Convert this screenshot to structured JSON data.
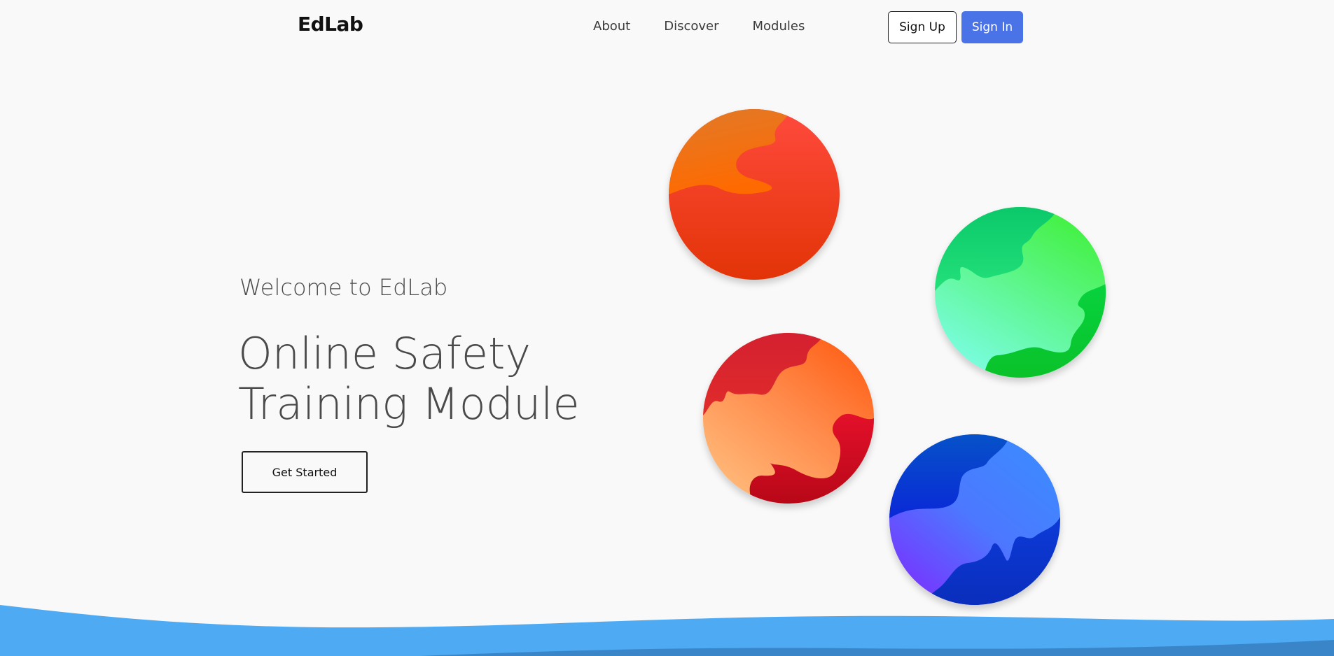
{
  "brand": {
    "name": "EdLab"
  },
  "nav": {
    "links": [
      {
        "label": "About"
      },
      {
        "label": "Discover"
      },
      {
        "label": "Modules"
      }
    ],
    "signup_label": "Sign Up",
    "signin_label": "Sign In"
  },
  "hero": {
    "subtitle": "Welcome to EdLab",
    "title_line1": "Online Safety",
    "title_line2": "Training Module",
    "cta_label": "Get Started"
  },
  "colors": {
    "accent": "#4a73e8",
    "background": "#f9f9f9",
    "wave": "#4eaaf2"
  }
}
